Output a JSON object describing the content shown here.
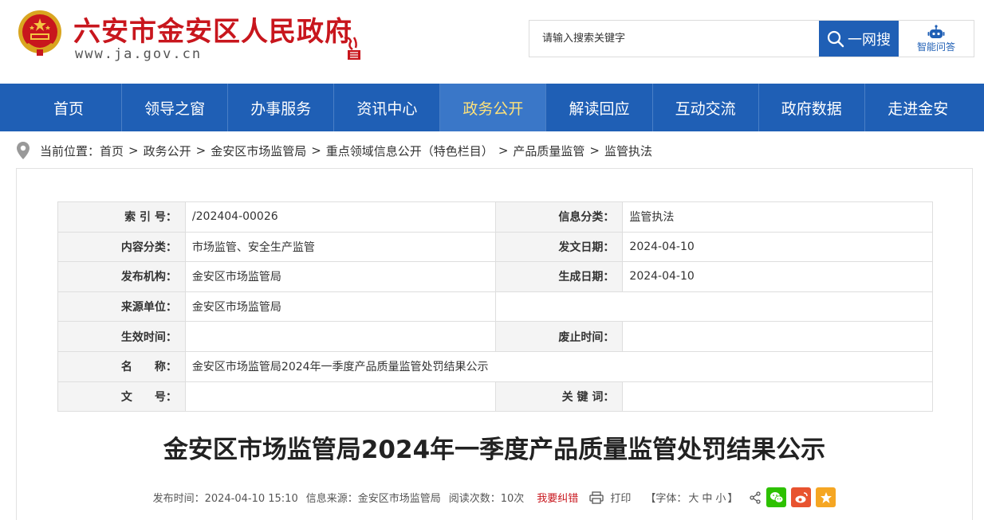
{
  "header": {
    "site_title": "六安市金安区人民政府",
    "site_domain": "www.ja.gov.cn",
    "search_placeholder": "请输入搜索关键字",
    "search_button": "一网搜",
    "qa_button": "智能问答"
  },
  "nav": {
    "items": [
      "首页",
      "领导之窗",
      "办事服务",
      "资讯中心",
      "政务公开",
      "解读回应",
      "互动交流",
      "政府数据",
      "走进金安"
    ],
    "active_index": 4
  },
  "breadcrumb": {
    "prefix": "当前位置：",
    "items": [
      "首页",
      "政务公开",
      "金安区市场监管局",
      "重点领域信息公开（特色栏目）",
      "产品质量监管",
      "监管执法"
    ],
    "separator": ">"
  },
  "meta": {
    "index_no_label": "索 引 号：",
    "index_no": "/202404-00026",
    "info_category_label": "信息分类：",
    "info_category": "监管执法",
    "content_category_label": "内容分类：",
    "content_category": "市场监管、安全生产监管",
    "issue_date_label": "发文日期：",
    "issue_date": "2024-04-10",
    "publisher_label": "发布机构：",
    "publisher": "金安区市场监管局",
    "created_date_label": "生成日期：",
    "created_date": "2024-04-10",
    "source_unit_label": "来源单位：",
    "source_unit": "金安区市场监管局",
    "effective_time_label": "生效时间：",
    "effective_time": "",
    "expiry_time_label": "废止时间：",
    "expiry_time": "",
    "name_label": "名　　称：",
    "name": "金安区市场监管局2024年一季度产品质量监管处罚结果公示",
    "doc_no_label": "文　　号：",
    "doc_no": "",
    "keywords_label": "关 键 词：",
    "keywords": ""
  },
  "article": {
    "title": "金安区市场监管局2024年一季度产品质量监管处罚结果公示",
    "publish_time": "发布时间：2024-04-10 15:10",
    "source": "信息来源：金安区市场监管局",
    "views": "阅读次数：10次",
    "report_link": "我要纠错",
    "print_label": "打印",
    "font_prefix": "【字体：",
    "font_large": "大",
    "font_medium": "中",
    "font_small": "小",
    "font_suffix": "】"
  },
  "colors": {
    "brand_red": "#c8161d",
    "nav_blue": "#1f5fb5",
    "nav_active": "#3a77c8",
    "nav_active_text": "#ffe27a",
    "wechat": "#2dc100",
    "weibo": "#e8532f",
    "favorite": "#f5a623"
  }
}
